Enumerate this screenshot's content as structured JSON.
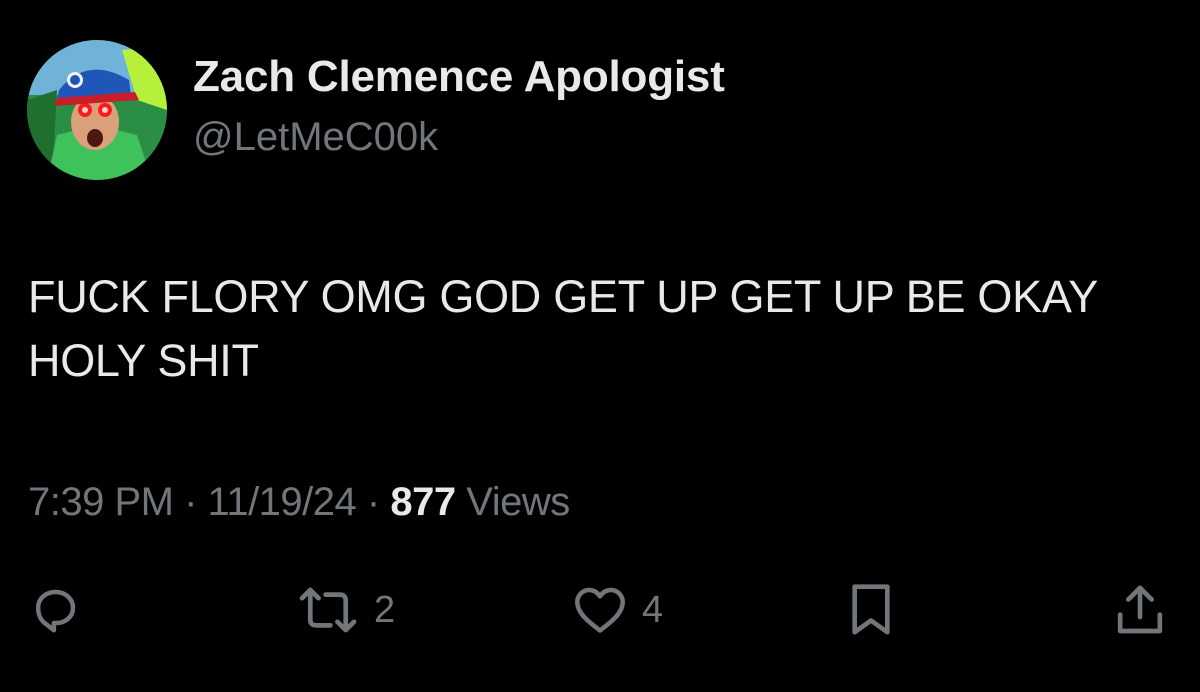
{
  "author": {
    "display_name": "Zach Clemence Apologist",
    "handle": "@LetMeC00k",
    "avatar_icon": "profile-avatar"
  },
  "tweet": {
    "text": "FUCK FLORY OMG GOD GET UP GET UP BE OKAY HOLY SHIT"
  },
  "meta": {
    "time": "7:39 PM",
    "separator": "·",
    "date": "11/19/24",
    "views_count": "877",
    "views_label": "Views"
  },
  "actions": {
    "reply": {
      "icon": "reply-icon",
      "count": ""
    },
    "retweet": {
      "icon": "retweet-icon",
      "count": "2"
    },
    "like": {
      "icon": "heart-icon",
      "count": "4"
    },
    "bookmark": {
      "icon": "bookmark-icon",
      "count": ""
    },
    "share": {
      "icon": "share-icon",
      "count": ""
    }
  },
  "colors": {
    "background": "#000000",
    "primary_text": "#e7e9ea",
    "secondary_text": "#71767b"
  }
}
